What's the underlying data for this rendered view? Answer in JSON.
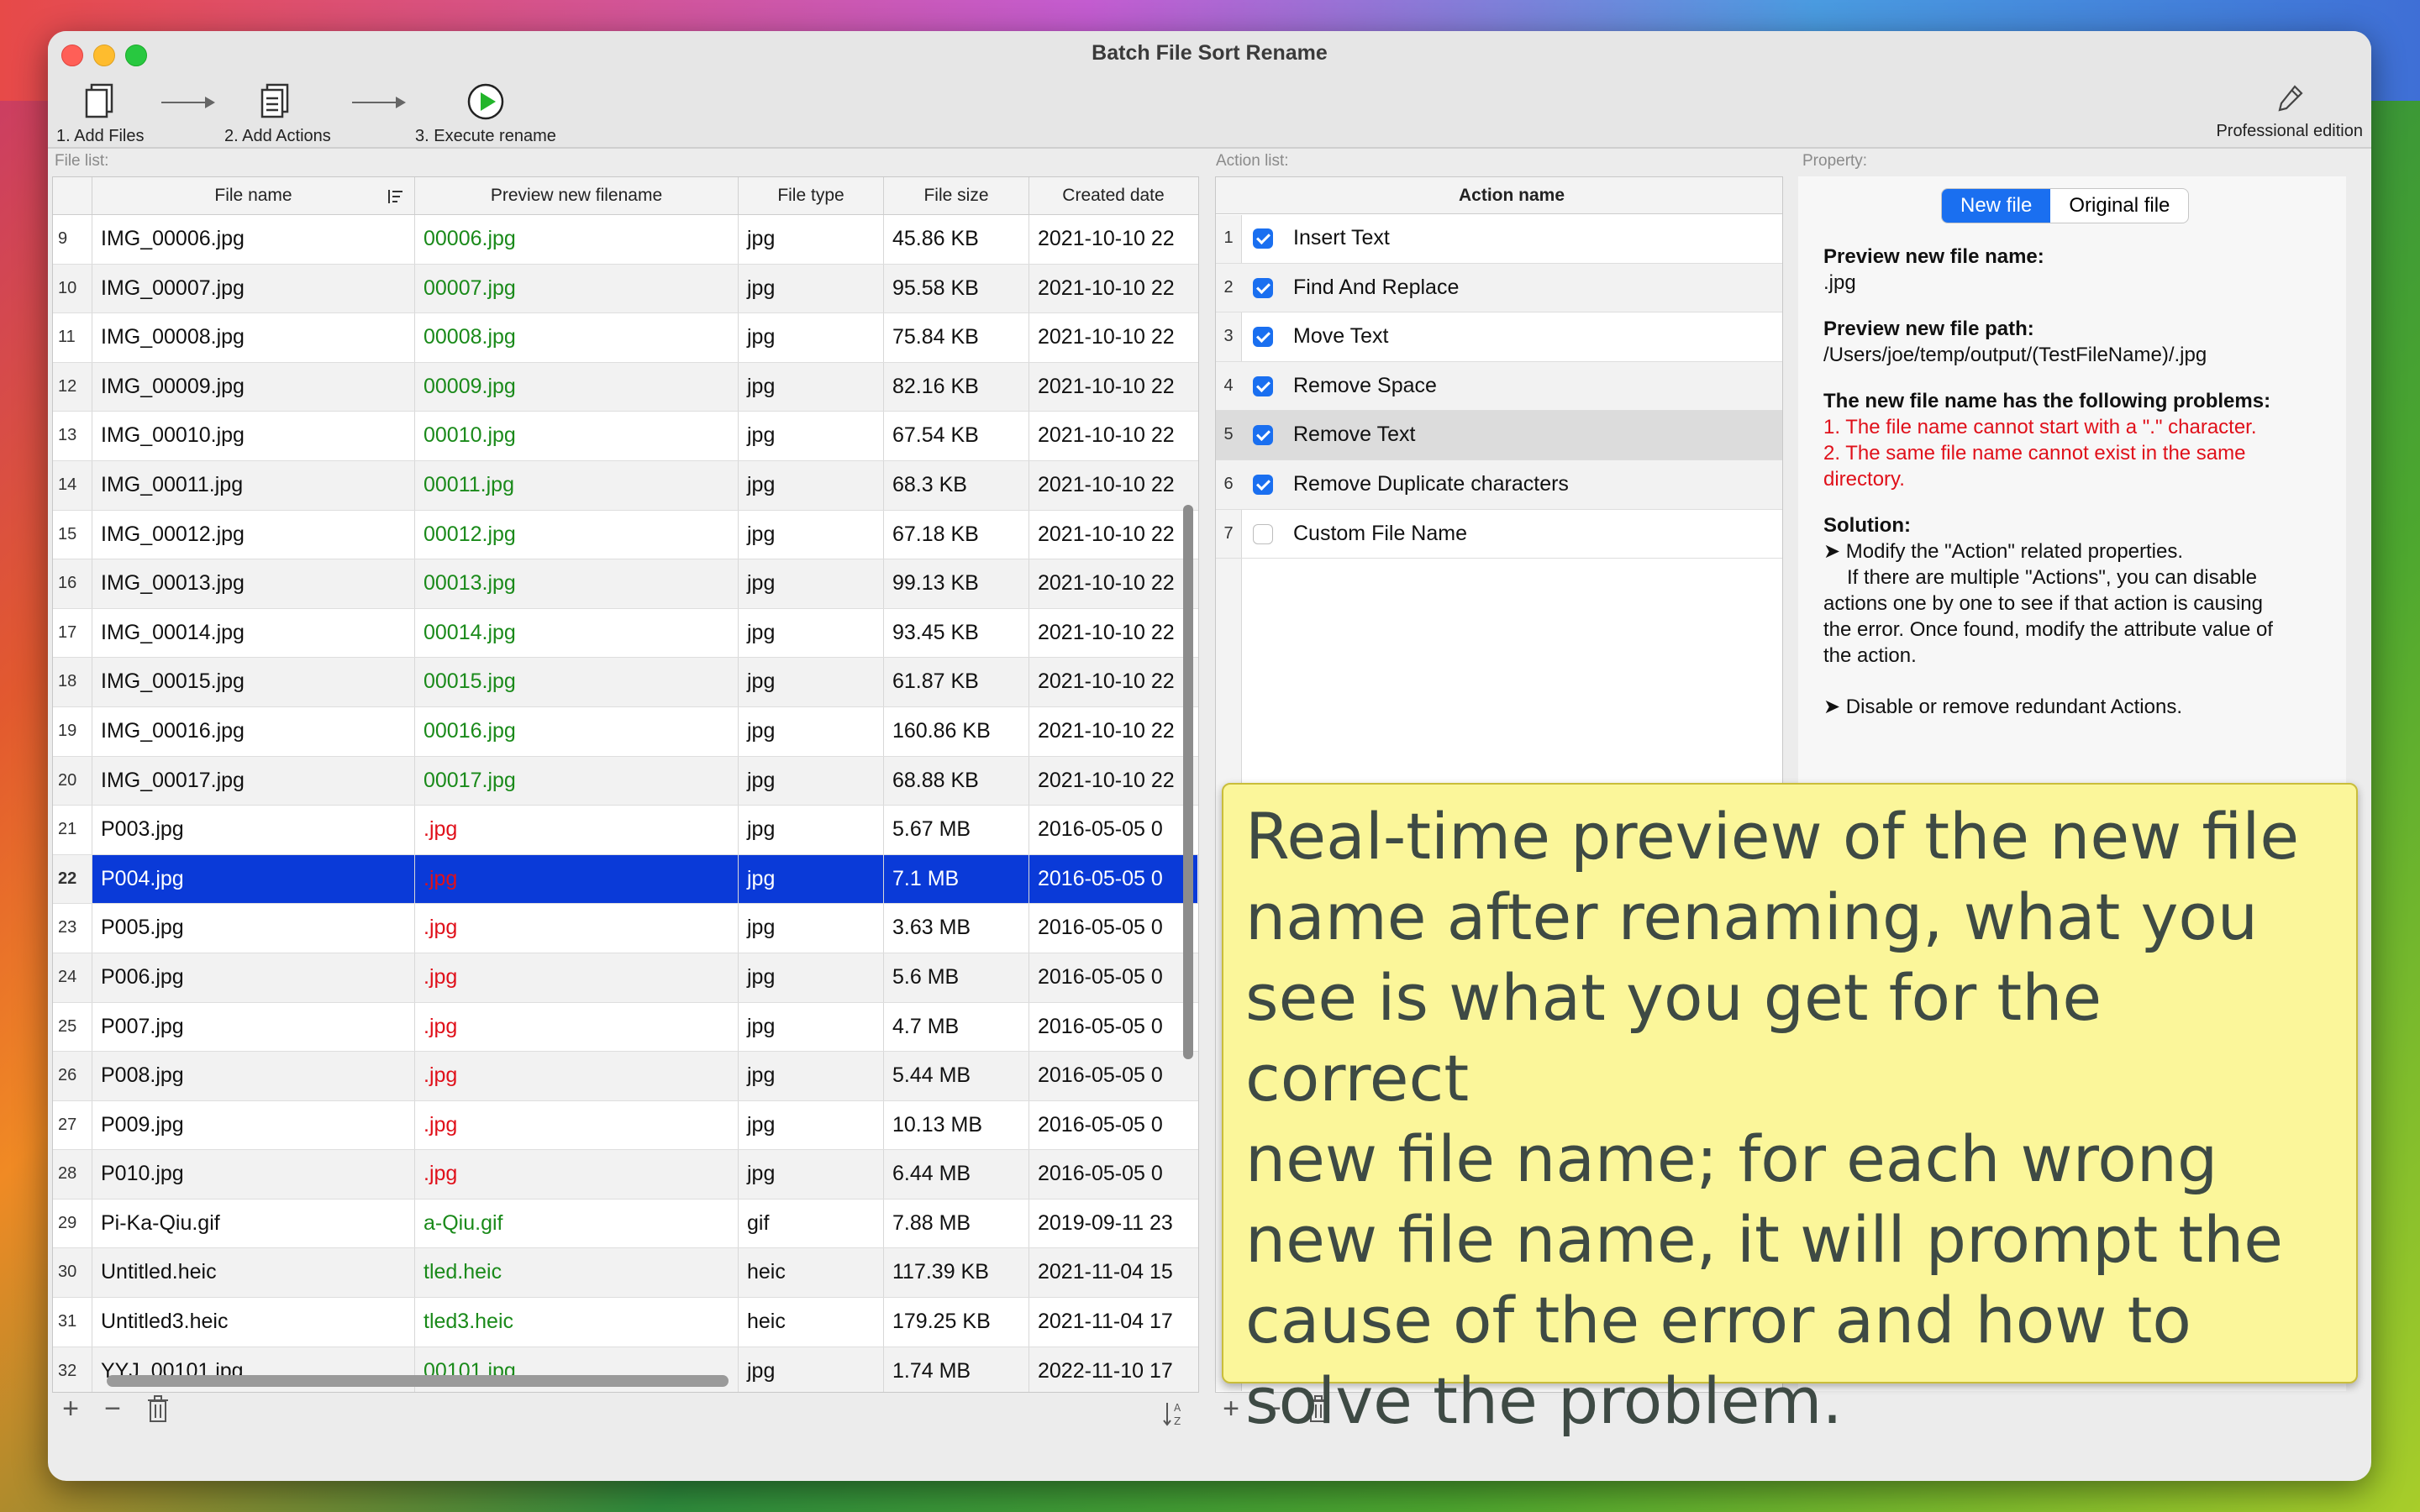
{
  "window": {
    "title": "Batch File Sort Rename"
  },
  "toolbar": {
    "add_files": "1. Add Files",
    "add_actions": "2. Add Actions",
    "execute_rename": "3. Execute rename",
    "professional": "Professional edition"
  },
  "labels": {
    "file_list": "File list:",
    "action_list": "Action list:",
    "property": "Property:"
  },
  "file_table": {
    "columns": [
      "File name",
      "Preview new filename",
      "File type",
      "File size",
      "Created date"
    ],
    "rows": [
      {
        "n": "9",
        "name": "IMG_00006.jpg",
        "preview": "00006.jpg",
        "type": "jpg",
        "size": "45.86 KB",
        "date": "2021-10-10 22"
      },
      {
        "n": "10",
        "name": "IMG_00007.jpg",
        "preview": "00007.jpg",
        "type": "jpg",
        "size": "95.58 KB",
        "date": "2021-10-10 22"
      },
      {
        "n": "11",
        "name": "IMG_00008.jpg",
        "preview": "00008.jpg",
        "type": "jpg",
        "size": "75.84 KB",
        "date": "2021-10-10 22"
      },
      {
        "n": "12",
        "name": "IMG_00009.jpg",
        "preview": "00009.jpg",
        "type": "jpg",
        "size": "82.16 KB",
        "date": "2021-10-10 22"
      },
      {
        "n": "13",
        "name": "IMG_00010.jpg",
        "preview": "00010.jpg",
        "type": "jpg",
        "size": "67.54 KB",
        "date": "2021-10-10 22"
      },
      {
        "n": "14",
        "name": "IMG_00011.jpg",
        "preview": "00011.jpg",
        "type": "jpg",
        "size": "68.3 KB",
        "date": "2021-10-10 22"
      },
      {
        "n": "15",
        "name": "IMG_00012.jpg",
        "preview": "00012.jpg",
        "type": "jpg",
        "size": "67.18 KB",
        "date": "2021-10-10 22"
      },
      {
        "n": "16",
        "name": "IMG_00013.jpg",
        "preview": "00013.jpg",
        "type": "jpg",
        "size": "99.13 KB",
        "date": "2021-10-10 22"
      },
      {
        "n": "17",
        "name": "IMG_00014.jpg",
        "preview": "00014.jpg",
        "type": "jpg",
        "size": "93.45 KB",
        "date": "2021-10-10 22"
      },
      {
        "n": "18",
        "name": "IMG_00015.jpg",
        "preview": "00015.jpg",
        "type": "jpg",
        "size": "61.87 KB",
        "date": "2021-10-10 22"
      },
      {
        "n": "19",
        "name": "IMG_00016.jpg",
        "preview": "00016.jpg",
        "type": "jpg",
        "size": "160.86 KB",
        "date": "2021-10-10 22"
      },
      {
        "n": "20",
        "name": "IMG_00017.jpg",
        "preview": "00017.jpg",
        "type": "jpg",
        "size": "68.88 KB",
        "date": "2021-10-10 22"
      },
      {
        "n": "21",
        "name": "P003.jpg",
        "preview": ".jpg",
        "type": "jpg",
        "size": "5.67 MB",
        "date": "2016-05-05 0"
      },
      {
        "n": "22",
        "name": "P004.jpg",
        "preview": ".jpg",
        "type": "jpg",
        "size": "7.1 MB",
        "date": "2016-05-05 0"
      },
      {
        "n": "23",
        "name": "P005.jpg",
        "preview": ".jpg",
        "type": "jpg",
        "size": "3.63 MB",
        "date": "2016-05-05 0"
      },
      {
        "n": "24",
        "name": "P006.jpg",
        "preview": ".jpg",
        "type": "jpg",
        "size": "5.6 MB",
        "date": "2016-05-05 0"
      },
      {
        "n": "25",
        "name": "P007.jpg",
        "preview": ".jpg",
        "type": "jpg",
        "size": "4.7 MB",
        "date": "2016-05-05 0"
      },
      {
        "n": "26",
        "name": "P008.jpg",
        "preview": ".jpg",
        "type": "jpg",
        "size": "5.44 MB",
        "date": "2016-05-05 0"
      },
      {
        "n": "27",
        "name": "P009.jpg",
        "preview": ".jpg",
        "type": "jpg",
        "size": "10.13 MB",
        "date": "2016-05-05 0"
      },
      {
        "n": "28",
        "name": "P010.jpg",
        "preview": ".jpg",
        "type": "jpg",
        "size": "6.44 MB",
        "date": "2016-05-05 0"
      },
      {
        "n": "29",
        "name": "Pi-Ka-Qiu.gif",
        "preview": "a-Qiu.gif",
        "type": "gif",
        "size": "7.88 MB",
        "date": "2019-09-11 23"
      },
      {
        "n": "30",
        "name": "Untitled.heic",
        "preview": "tled.heic",
        "type": "heic",
        "size": "117.39 KB",
        "date": "2021-11-04 15"
      },
      {
        "n": "31",
        "name": "Untitled3.heic",
        "preview": "tled3.heic",
        "type": "heic",
        "size": "179.25 KB",
        "date": "2021-11-04 17"
      },
      {
        "n": "32",
        "name": "YYJ_00101.jpg",
        "preview": "00101.jpg",
        "type": "jpg",
        "size": "1.74 MB",
        "date": "2022-11-10 17"
      }
    ]
  },
  "action_table": {
    "header": "Action name",
    "rows": [
      {
        "n": "1",
        "label": "Insert Text",
        "checked": true
      },
      {
        "n": "2",
        "label": "Find And Replace",
        "checked": true
      },
      {
        "n": "3",
        "label": "Move Text",
        "checked": true
      },
      {
        "n": "4",
        "label": "Remove Space",
        "checked": true
      },
      {
        "n": "5",
        "label": "Remove Text",
        "checked": true
      },
      {
        "n": "6",
        "label": "Remove Duplicate characters",
        "checked": true
      },
      {
        "n": "7",
        "label": "Custom File Name",
        "checked": false
      }
    ]
  },
  "property": {
    "seg_new": "New file",
    "seg_original": "Original file",
    "preview_name_label": "Preview new file name:",
    "preview_name": ".jpg",
    "preview_path_label": "Preview new file path:",
    "preview_path": "/Users/joe/temp/output/(TestFileName)/.jpg",
    "problems_label": "The new file name has the following problems:",
    "problem1": "1. The file name cannot start with a \".\" character.",
    "problem2a": "2. The same file name cannot exist in the same",
    "problem2b": "directory.",
    "solution_label": "Solution:",
    "sol1": "➤ Modify the \"Action\" related properties.",
    "sol2": "If there are multiple \"Actions\", you can disable",
    "sol3": "actions one by one to see if that action is causing",
    "sol4": "the error. Once found, modify the attribute value of",
    "sol5": "the action.",
    "sol6": "➤ Disable or remove redundant Actions."
  },
  "callout": {
    "line1": "Real-time preview of the new file",
    "line2": "name after renaming, what you",
    "line3": "see is what you get for the correct",
    "line4": "new file name; for each wrong",
    "line5": "new file name, it will prompt the",
    "line6": "cause of the error and how to",
    "line7": "solve the problem."
  },
  "bottom": {
    "add": "+",
    "remove": "−"
  },
  "colors": {
    "accent": "#1a6ff0",
    "selection": "#0a3ad8",
    "ok": "#1a8a1a",
    "error": "#e0101a",
    "callout": "#fbf69a"
  }
}
